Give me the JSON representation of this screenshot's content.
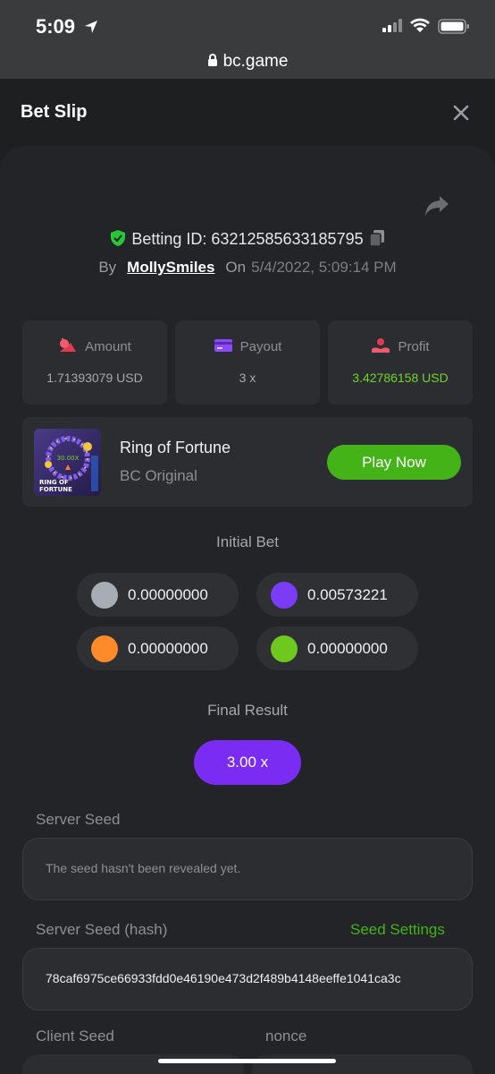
{
  "status": {
    "time": "5:09"
  },
  "browser": {
    "url": "bc.game"
  },
  "sheet": {
    "title": "Bet Slip"
  },
  "bet": {
    "id_label": "Betting ID: 63212585633185795",
    "by_label": "By",
    "user": "MollySmiles",
    "on_label": "On",
    "date": "5/4/2022, 5:09:14 PM"
  },
  "stats": {
    "amount": {
      "label": "Amount",
      "value": "1.71393079 USD"
    },
    "payout": {
      "label": "Payout",
      "value": "3 x"
    },
    "profit": {
      "label": "Profit",
      "value": "3.42786158 USD"
    }
  },
  "game": {
    "name": "Ring of Fortune",
    "subtitle": "BC Original",
    "play_label": "Play Now",
    "thumb_multiplier": "30.00X",
    "thumb_title_1": "RING OF",
    "thumb_title_2": "FORTUNE"
  },
  "initial_bet": {
    "label": "Initial Bet",
    "coins": [
      {
        "color": "#a7adb5",
        "value": "0.00000000"
      },
      {
        "color": "#7a3cf5",
        "value": "0.00573221"
      },
      {
        "color": "#ff8a2a",
        "value": "0.00000000"
      },
      {
        "color": "#6fc81e",
        "value": "0.00000000"
      }
    ]
  },
  "final_result": {
    "label": "Final Result",
    "value": "3.00 x"
  },
  "server_seed": {
    "label": "Server Seed",
    "value": "The seed hasn't been revealed yet."
  },
  "server_seed_hash": {
    "label": "Server Seed (hash)",
    "settings_label": "Seed Settings",
    "value": "78caf6975ce66933fdd0e46190e473d2f489b4148eeffe1041ca3c"
  },
  "client_seed": {
    "label": "Client Seed"
  },
  "nonce": {
    "label": "nonce"
  },
  "colors": {
    "accent_green": "#43b318",
    "accent_purple": "#7a2cf3",
    "profit_green": "#6fd42a"
  }
}
